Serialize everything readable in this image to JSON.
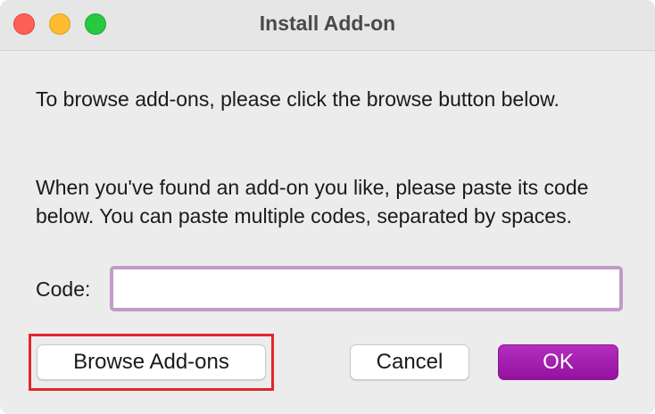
{
  "window": {
    "title": "Install Add-on",
    "controls": [
      "close-icon",
      "minimize-icon",
      "zoom-icon"
    ]
  },
  "body": {
    "paragraph1": "To browse add-ons, please click the browse button below.",
    "paragraph2": "When you've found an add-on you like, please paste its code below. You can paste multiple codes, separated by spaces."
  },
  "code": {
    "label": "Code:",
    "value": "",
    "placeholder": ""
  },
  "buttons": {
    "browse": "Browse Add-ons",
    "cancel": "Cancel",
    "ok": "OK"
  },
  "colors": {
    "accent": "#a11fad",
    "focus_ring": "#c39bc9",
    "highlight": "#e0262c"
  }
}
